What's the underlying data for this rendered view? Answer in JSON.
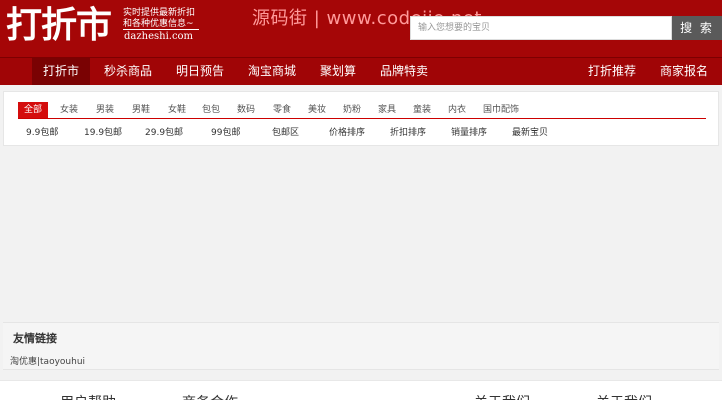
{
  "header": {
    "logo": "打折市",
    "slogan_line1": "实时提供最新折扣",
    "slogan_line2": "和各种优惠信息~",
    "domain": "dazheshi.com",
    "watermark": "源码街 | www.codejie.net",
    "search_placeholder": "输入您想要的宝贝",
    "search_button": "搜 索"
  },
  "nav": {
    "items": [
      "打折市",
      "秒杀商品",
      "明日预告",
      "淘宝商城",
      "聚划算",
      "品牌特卖",
      "打折推荐",
      "商家报名"
    ]
  },
  "categories": {
    "tabs": [
      "全部",
      "女装",
      "男装",
      "男鞋",
      "女鞋",
      "包包",
      "数码",
      "零食",
      "美妆",
      "奶粉",
      "家具",
      "童装",
      "内衣",
      "国巾配饰"
    ]
  },
  "filters": {
    "items": [
      "9.9包邮",
      "19.9包邮",
      "29.9包邮",
      "99包邮",
      "包邮区",
      "价格排序",
      "折扣排序",
      "销量排序",
      "最新宝贝"
    ]
  },
  "friends": {
    "title": "友情链接",
    "link": "淘优惠|taoyouhui"
  },
  "footer": {
    "items": [
      "用户帮助",
      "商务合作",
      "关于我们",
      "关于我们"
    ]
  }
}
